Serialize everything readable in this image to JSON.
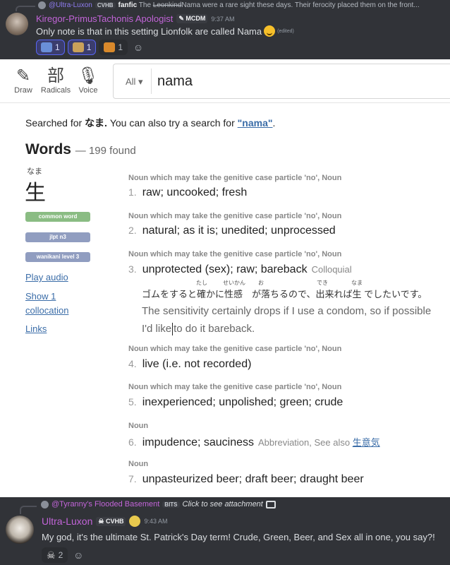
{
  "discord_top": {
    "reply": {
      "author": "@Ultra-Luxon",
      "tag": "CVHB",
      "title": "fanfic",
      "struck": "Leonkind",
      "text": "Nama were a rare sight these days. Their ferocity placed them on the front..."
    },
    "message": {
      "author": "Kiregor-PrimusTachonis Apologist",
      "role_tag": "MCDM",
      "time": "9:37 AM",
      "text": "Only note is that in this setting Lionfolk are called Nama",
      "edited": "(edited)"
    },
    "reactions": [
      {
        "emoji": "wizard-emoji",
        "count": "1",
        "color": "#6a8fd8"
      },
      {
        "emoji": "scroll-emoji",
        "count": "1",
        "color": "#c9a15a"
      },
      {
        "emoji": "lion-emoji",
        "count": "1",
        "color": "#d9892b"
      }
    ]
  },
  "jisho": {
    "tools": [
      {
        "label": "Draw",
        "glyph": "✎"
      },
      {
        "label": "Radicals",
        "glyph": "部"
      },
      {
        "label": "Voice",
        "glyph": "🎙"
      }
    ],
    "search": {
      "scope": "All ▾",
      "value": "nama"
    },
    "searched": {
      "prefix": "Searched for ",
      "term": "なま.",
      "middle": " You can also try a search for ",
      "alt": "\"nama\"",
      "suffix": "."
    },
    "words": {
      "title": "Words",
      "count": "— 199 found"
    },
    "entry": {
      "furigana": "なま",
      "kanji": "生",
      "badges": {
        "common": "common word",
        "jlpt": "jlpt n3",
        "wanikani": "wanikani level 3"
      },
      "links": {
        "audio": "Play audio",
        "collocation": "Show 1 collocation",
        "links": "Links"
      }
    },
    "senses": [
      {
        "tag": "Noun which may take the genitive case particle 'no', Noun",
        "num": "1.",
        "text": "raw; uncooked; fresh",
        "extra": ""
      },
      {
        "tag": "Noun which may take the genitive case particle 'no', Noun",
        "num": "2.",
        "text": "natural; as it is; unedited; unprocessed",
        "extra": ""
      },
      {
        "tag": "Noun which may take the genitive case particle 'no', Noun",
        "num": "3.",
        "text": "unprotected (sex); raw; bareback",
        "extra": "Colloquial"
      },
      {
        "tag": "Noun which may take the genitive case particle 'no', Noun",
        "num": "4.",
        "text": "live (i.e. not recorded)",
        "extra": ""
      },
      {
        "tag": "Noun which may take the genitive case particle 'no', Noun",
        "num": "5.",
        "text": "inexperienced; unpolished; green; crude",
        "extra": ""
      },
      {
        "tag": "Noun",
        "num": "6.",
        "text": "impudence; sauciness",
        "extra": "Abbreviation, See also ",
        "extra_link": "生意気"
      },
      {
        "tag": "Noun",
        "num": "7.",
        "text": "unpasteurized beer; draft beer; draught beer",
        "extra": ""
      }
    ],
    "example": {
      "jp": "ゴムをすると確かに性感　が落ちるので、出来れば生 でしたいです。",
      "ruby": [
        "たし",
        "せいかん",
        "お",
        "でき",
        "なま"
      ],
      "en_before": "The sensitivity certainly drops if I use a condom, so if possible I'd like",
      "en_after": "to do it bareback."
    }
  },
  "discord_bottom": {
    "reply": {
      "author": "@Tyranny's Flooded Basement",
      "tag": "BITS",
      "text": "Click to see attachment"
    },
    "message": {
      "author": "Ultra-Luxon",
      "tag": "CVHB",
      "time": "9:43 AM",
      "text": "My god, it's the ultimate St. Patrick's Day term! Crude, Green, Beer, and Sex all in one, you say?!"
    },
    "reactions": [
      {
        "emoji": "skull-emoji",
        "count": "2"
      }
    ]
  }
}
